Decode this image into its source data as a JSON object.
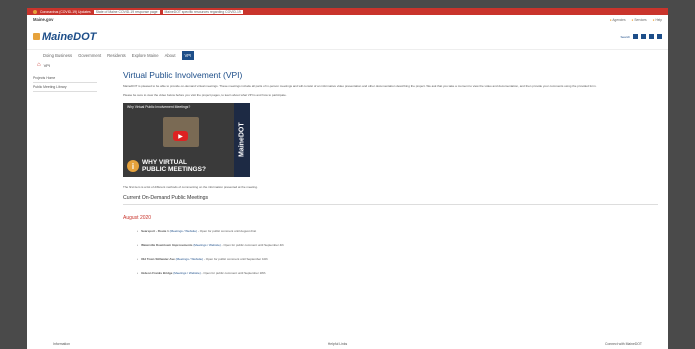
{
  "alert": {
    "label": "Coronavirus (COVID-19) Updates",
    "item1": "State of Maine COVID-19 response page",
    "item2": "MaineDOT specific resources regarding COVID-19"
  },
  "topstrip": {
    "site_name": "Maine.gov",
    "links": [
      "Agencies",
      "Services",
      "Help"
    ]
  },
  "header": {
    "logo": "MaineDOT",
    "search_label": "Search"
  },
  "nav": {
    "items": [
      "Doing Business",
      "Government",
      "Residents",
      "Explore Maine",
      "About",
      "VPI"
    ]
  },
  "breadcrumb": {
    "label": "VPI"
  },
  "sidebar": {
    "items": [
      "Projects Home",
      "Public Meeting Library"
    ]
  },
  "main": {
    "title": "Virtual Public Involvement (VPI)",
    "intro": "MaineDOT is pleased to be able to provide on-demand virtual meetings. These meetings include all parts of in-person meetings and will consist of an informative video presentation and other documentation describing the project. We ask that you take a moment to view the video and documentation, and then provide your comments using the provided form.",
    "intro2": "Please be sure to view the video below before you visit the project pages, to learn about what VPI is and how to participate.",
    "video": {
      "title": "Why Virtual Public Involvement Meetings?",
      "why_line1": "WHY VIRTUAL",
      "why_line2": "PUBLIC MEETINGS?",
      "brand": "MaineDOT"
    },
    "note": "The first item is a list of different methods of commenting on the information presented at the meeting.",
    "section_title": "Current On-Demand Public Meetings",
    "month": "August 2020",
    "meetings": [
      {
        "name": "Searsport - Route 1",
        "link": "(Meetings / Website)",
        "detail": " - Open for public comment until August 21st"
      },
      {
        "name": "Waterville Downtown Improvements",
        "link": "(Meetings / Website)",
        "detail": " - Open for public comment until September 4th"
      },
      {
        "name": "Old Town Stillwater Ave",
        "link": "(Meetings / Website)",
        "detail": " - Open for public comment until September 10th"
      },
      {
        "name": "Gideon Franks Bridge",
        "link": "(Meetings / Website)",
        "detail": " - Open for public comment until September 18th"
      }
    ]
  },
  "footer": {
    "col1": "Information",
    "col2": "Helpful Links",
    "col3": "Connect with MaineDOT"
  }
}
